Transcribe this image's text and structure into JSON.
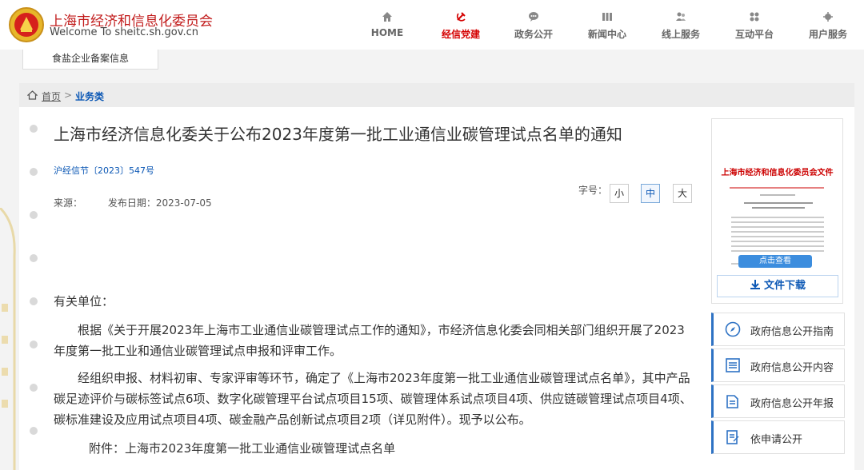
{
  "header": {
    "site_name_cn": "上海市经济和信息化委员会",
    "site_name_en": "Welcome To sheitc.sh.gov.cn",
    "nav": [
      {
        "label": "HOME",
        "icon": "home-icon"
      },
      {
        "label": "经信党建",
        "icon": "hammer-sickle-icon",
        "active": true
      },
      {
        "label": "政务公开",
        "icon": "chat-icon"
      },
      {
        "label": "新闻中心",
        "icon": "news-icon"
      },
      {
        "label": "线上服务",
        "icon": "users-icon"
      },
      {
        "label": "互动平台",
        "icon": "interaction-icon"
      },
      {
        "label": "用户服务",
        "icon": "user-service-icon"
      }
    ]
  },
  "strip_tab": "食盐企业备案信息",
  "breadcrumb": {
    "home": "首页",
    "separator": ">",
    "current": "业务类"
  },
  "article": {
    "title": "上海市经济信息化委关于公布2023年度第一批工业通信业碳管理试点名单的通知",
    "doc_number": "沪经信节〔2023〕547号",
    "source_label": "来源：",
    "date_label": "发布日期：2023-07-05",
    "font_size_label": "字号：",
    "font_sizes": [
      "小",
      "中",
      "大"
    ],
    "salutation": "有关单位：",
    "p1": "根据《关于开展2023年上海市工业通信业碳管理试点工作的通知》，市经济信息化委会同相关部门组织开展了2023年度第一批工业和通信业碳管理试点申报和评审工作。",
    "p2": "经组织申报、材料初审、专家评审等环节，确定了《上海市2023年度第一批工业通信业碳管理试点名单》，其中产品碳足迹评价与碳标签试点6项、数字化碳管理平台试点项目15项、碳管理体系试点项目4项、供应链碳管理试点项目4项、碳标准建设及应用试点项目4项、碳金融产品创新试点项目2项（详见附件）。现予以公布。",
    "attachment": "附件：上海市2023年度第一批工业通信业碳管理试点名单"
  },
  "sidebar": {
    "thumb_title": "上海市经济和信息化委员会文件",
    "view_label": "点击查看",
    "download_label": "文件下载",
    "links": [
      {
        "label": "政府信息公开指南",
        "icon": "compass-icon"
      },
      {
        "label": "政府信息公开内容",
        "icon": "list-icon"
      },
      {
        "label": "政府信息公开年报",
        "icon": "report-icon"
      },
      {
        "label": "依申请公开",
        "icon": "apply-icon"
      }
    ]
  },
  "colors": {
    "brand_red": "#c11a1a",
    "active_red": "#d40000",
    "link_blue": "#0c58b5",
    "accent_blue": "#2e72c4"
  }
}
